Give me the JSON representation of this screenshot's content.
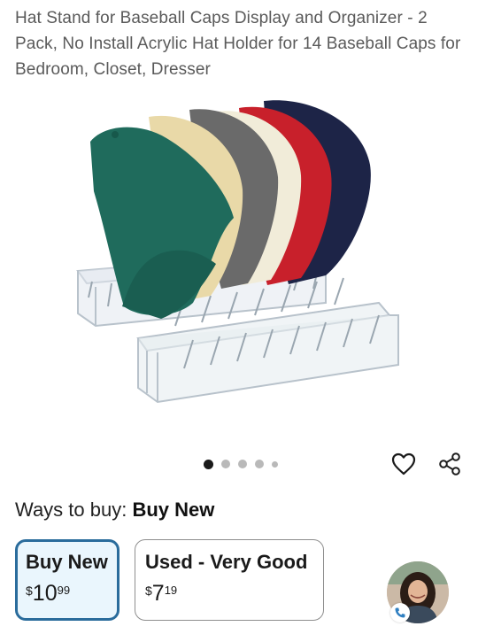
{
  "product": {
    "title": "Hat Stand for Baseball Caps Display and Organizer - 2 Pack, No Install Acrylic Hat Holder for 14 Baseball Caps for Bedroom, Closet, Dresser",
    "image_icon": "product-photo-hats-on-acrylic-stands",
    "carousel": {
      "total_dots": 5,
      "active_index": 0
    }
  },
  "actions": {
    "favorite_icon": "heart-outline-icon",
    "share_icon": "share-icon"
  },
  "buying": {
    "ways_label": "Ways to buy:",
    "ways_selected": "Buy New",
    "options": [
      {
        "label": "Buy New",
        "price_symbol": "$",
        "price_whole": "10",
        "price_fraction": "99",
        "selected": true
      },
      {
        "label": "Used - Very Good",
        "price_symbol": "$",
        "price_whole": "7",
        "price_fraction": "19",
        "selected": false
      }
    ]
  },
  "assistant": {
    "avatar_icon": "assistant-avatar",
    "badge_icon": "phone-icon"
  },
  "colors": {
    "selected_border": "#2a6c9c",
    "selected_bg": "#eaf6fd",
    "title_text": "#5a5a5a",
    "dot_active": "#1a1a1a",
    "dot_inactive": "#b9b9b9",
    "cap_colors": [
      "#1f6b5c",
      "#e9d9a8",
      "#6a6a6a",
      "#f1ecd9",
      "#c8202b",
      "#1d2447"
    ]
  }
}
